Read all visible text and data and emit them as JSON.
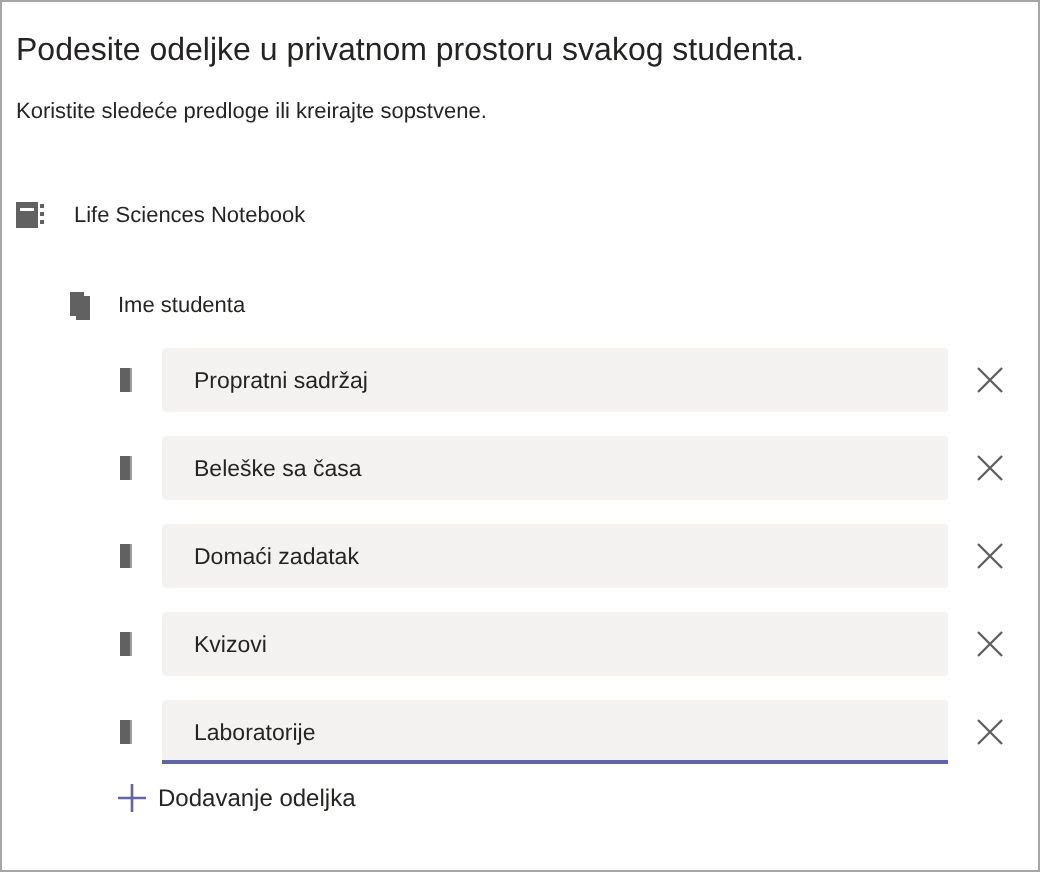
{
  "title": "Podesite odeljke u privatnom prostoru svakog studenta.",
  "subtitle": "Koristite sledeće predloge ili kreirajte sopstvene.",
  "notebook": {
    "name": "Life Sciences Notebook"
  },
  "student": {
    "name": "Ime studenta"
  },
  "sections": [
    {
      "value": "Propratni sadržaj",
      "focused": false
    },
    {
      "value": "Beleške sa časa",
      "focused": false
    },
    {
      "value": "Domaći zadatak",
      "focused": false
    },
    {
      "value": "Kvizovi",
      "focused": false
    },
    {
      "value": "Laboratorije",
      "focused": true
    }
  ],
  "add_section": {
    "label": "Dodavanje odeljka"
  }
}
